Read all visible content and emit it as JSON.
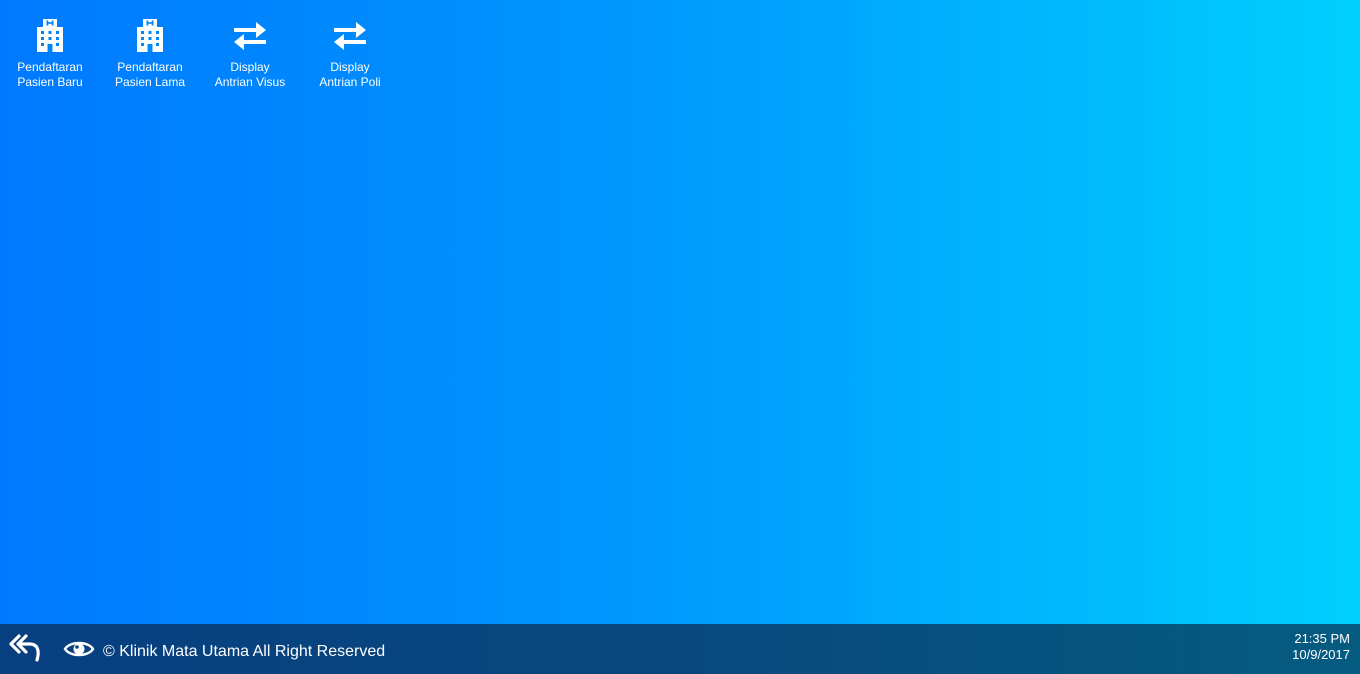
{
  "desktop": {
    "background": {
      "left": "#0079fe",
      "right": "#00cffd"
    },
    "icons": [
      {
        "icon": "hospital-icon",
        "line1": "Pendaftaran",
        "line2": "Pasien Baru"
      },
      {
        "icon": "hospital-icon",
        "line1": "Pendaftaran",
        "line2": "Pasien Lama"
      },
      {
        "icon": "swap-arrows-icon",
        "line1": "Display",
        "line2": "Antrian Visus"
      },
      {
        "icon": "swap-arrows-icon",
        "line1": "Display",
        "line2": "Antrian Poli"
      }
    ]
  },
  "taskbar": {
    "back_icon": "reply-all-icon",
    "eye_icon": "eye-icon",
    "copyright": "© Klinik Mata Utama All Right Reserved",
    "clock": {
      "time": "21:35 PM",
      "date": "10/9/2017"
    },
    "color": "#08487e"
  }
}
